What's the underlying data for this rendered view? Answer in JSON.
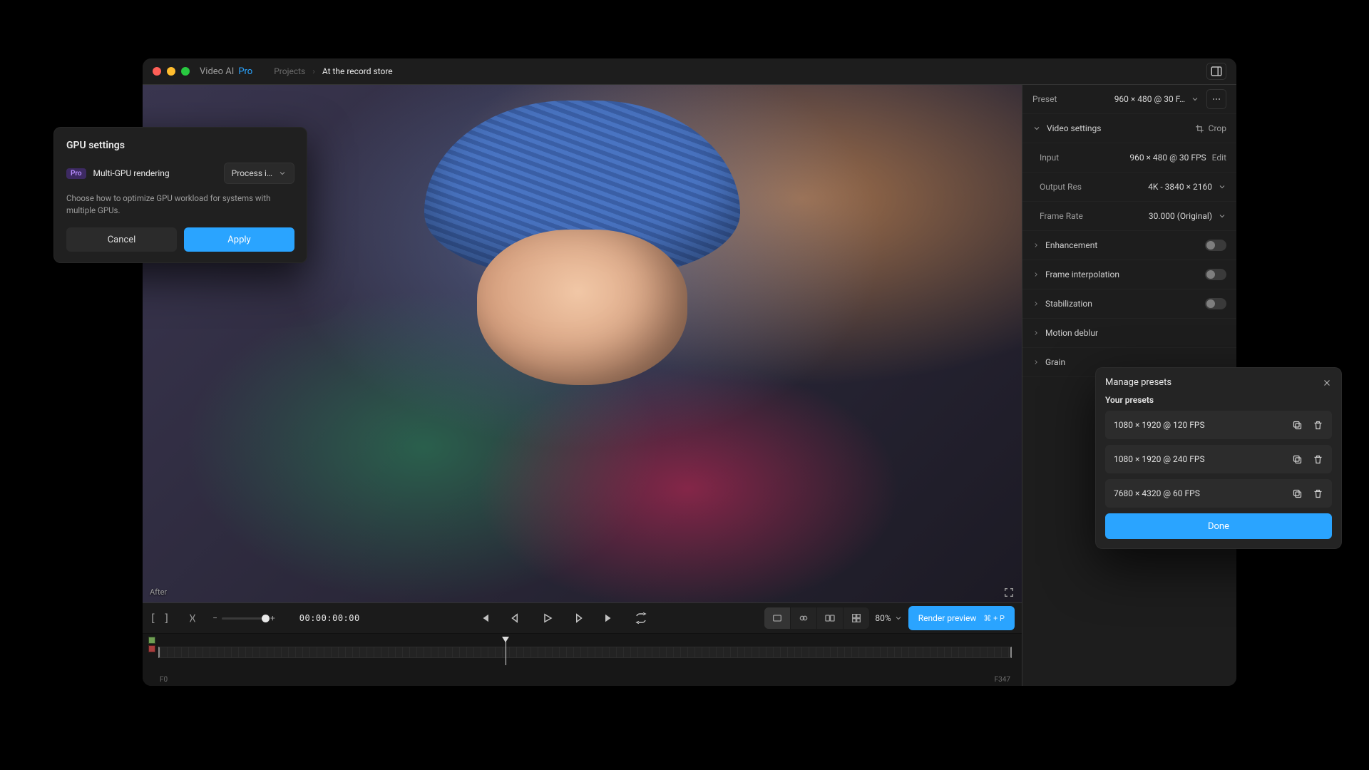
{
  "colors": {
    "accent": "#2aa4ff"
  },
  "titlebar": {
    "app_name": "Video AI",
    "app_edition": "Pro",
    "breadcrumb_root": "Projects",
    "breadcrumb_project": "At the record store"
  },
  "viewer": {
    "overlay_label": "After"
  },
  "controls": {
    "bracket_in": "[",
    "bracket_out": "]",
    "timecode": "00:00:00:00",
    "zoom_pct": "80%",
    "render_label": "Render preview",
    "render_shortcut": "⌘ + P"
  },
  "timeline": {
    "frame_start": "F0",
    "frame_end": "F347"
  },
  "sidebar": {
    "preset_label": "Preset",
    "preset_value": "960 × 480 @ 30 F…",
    "video_section": "Video settings",
    "crop_label": "Crop",
    "input_label": "Input",
    "input_value": "960 × 480 @ 30 FPS",
    "edit_label": "Edit",
    "outputres_label": "Output Res",
    "outputres_value": "4K - 3840 × 2160",
    "framerate_label": "Frame Rate",
    "framerate_value": "30.000 (Original)",
    "enhancement_label": "Enhancement",
    "frameinterp_label": "Frame interpolation",
    "stabilization_label": "Stabilization",
    "motiondeblur_label": "Motion deblur",
    "grain_label": "Grain"
  },
  "gpu": {
    "title": "GPU settings",
    "pro_badge": "Pro",
    "row_label": "Multi-GPU rendering",
    "select_value": "Process i…",
    "description": "Choose how to optimize GPU workload for systems with multiple GPUs.",
    "cancel": "Cancel",
    "apply": "Apply"
  },
  "presets": {
    "title": "Manage presets",
    "subtitle": "Your presets",
    "items": [
      {
        "label": "1080 × 1920 @ 120 FPS"
      },
      {
        "label": "1080 × 1920 @ 240 FPS"
      },
      {
        "label": "7680 × 4320 @ 60 FPS"
      }
    ],
    "done": "Done"
  }
}
